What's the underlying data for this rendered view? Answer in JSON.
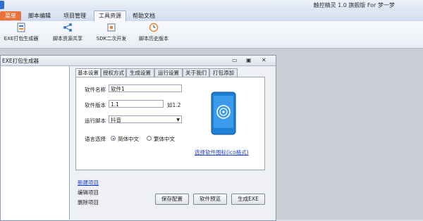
{
  "app": {
    "title": "触控精灵 1.0 旗舰版 For 梦一梦"
  },
  "menu": {
    "tabs": [
      "菜单",
      "脚本编辑",
      "项目管理",
      "工具资源",
      "帮助文档"
    ],
    "active_index": 3
  },
  "toolbar": {
    "buttons": [
      {
        "label": "EXE打包生成器",
        "icon": "package-icon"
      },
      {
        "label": "脚本资源共享",
        "icon": "share-icon"
      },
      {
        "label": "SDK二次开发",
        "icon": "sdk-icon"
      },
      {
        "label": "脚本历史版本",
        "icon": "clock-icon"
      }
    ]
  },
  "panel": {
    "title": "EXE打包生成器"
  },
  "tabs": [
    "基本设置",
    "授权方式",
    "生成设置",
    "运行设置",
    "关于我们",
    "打包添加"
  ],
  "form": {
    "name_label": "软件名称",
    "name_value": "软件1",
    "version_label": "软件版本",
    "version_value": "1.1",
    "version_hint": "如1.2",
    "script_label": "运行脚本",
    "script_value": "抖音",
    "lang_label": "语言选择",
    "lang_options": [
      "简体中文",
      "繁体中文"
    ],
    "lang_selected": 0,
    "icon_link": "选择软件图标(ico格式)"
  },
  "project_links": {
    "new": "新建项目",
    "edit": "编辑项目",
    "delete": "删除项目"
  },
  "actions": {
    "save": "保存配置",
    "preview": "软件预览",
    "generate": "生成EXE"
  },
  "colors": {
    "start_tab": "#e8743b",
    "link": "#1a3fc2",
    "phone_blue": "#1e7fd6"
  }
}
